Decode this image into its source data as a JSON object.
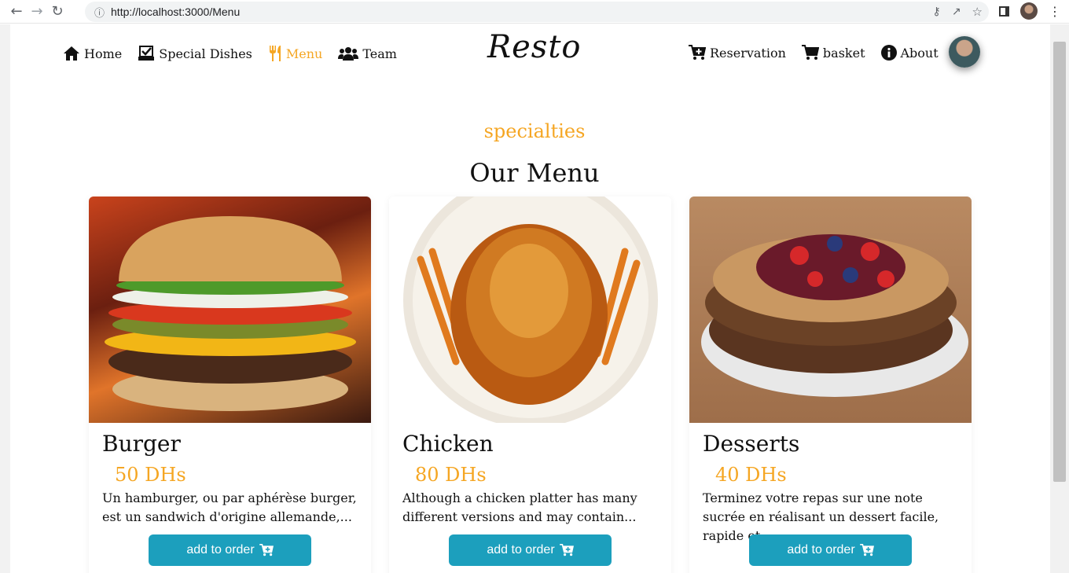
{
  "browser": {
    "url": "http://localhost:3000/Menu"
  },
  "nav": {
    "left": [
      {
        "label": "Home",
        "icon": "home-icon"
      },
      {
        "label": "Special Dishes",
        "icon": "checkbox-tray-icon"
      },
      {
        "label": "Menu",
        "icon": "utensils-icon",
        "active": true
      },
      {
        "label": "Team",
        "icon": "users-icon"
      }
    ],
    "logo": "Resto",
    "right": [
      {
        "label": "Reservation",
        "icon": "cart-plus-icon"
      },
      {
        "label": "basket",
        "icon": "cart-icon"
      },
      {
        "label": "About",
        "icon": "info-icon"
      }
    ]
  },
  "section": {
    "subtitle": "specialties",
    "title": "Our Menu"
  },
  "cards": [
    {
      "name": "Burger",
      "price": "50 DHs",
      "desc": "Un hamburger, ou par aphérèse burger, est un sandwich d'origine allemande,...",
      "button": "add to order"
    },
    {
      "name": "Chicken",
      "price": "80 DHs",
      "desc": "Although a chicken platter has many different versions and may contain...",
      "button": "add to order"
    },
    {
      "name": "Desserts",
      "price": "40 DHs",
      "desc": "Terminez votre repas sur une note sucrée en réalisant un dessert facile, rapide et...",
      "button": "add to order"
    }
  ],
  "colors": {
    "accent": "#f5a623",
    "button": "#1c9fbd"
  }
}
